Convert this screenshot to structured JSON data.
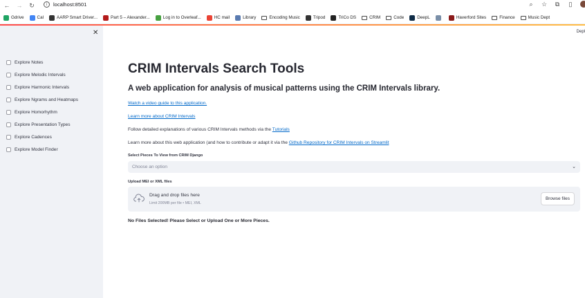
{
  "browser": {
    "url": "localhost:8501",
    "bookmarks": [
      {
        "label": "Gdrive",
        "color": "#1fa463"
      },
      {
        "label": "Cal",
        "color": "#4285f4"
      },
      {
        "label": "AARP Smart Driver...",
        "color": "#333333"
      },
      {
        "label": "Part 5 – Alexander...",
        "color": "#b31b1b"
      },
      {
        "label": "Log in to Overleaf...",
        "color": "#47a141"
      },
      {
        "label": "HC mail",
        "color": "#ea4335"
      },
      {
        "label": "Library",
        "color": "#5a7bb0"
      },
      {
        "label": "Encoding Music",
        "color": "folder"
      },
      {
        "label": "Tripod",
        "color": "#333333"
      },
      {
        "label": "TriCo DS",
        "color": "#222222"
      },
      {
        "label": "CRIM",
        "color": "folder"
      },
      {
        "label": "Code",
        "color": "folder"
      },
      {
        "label": "DeepL",
        "color": "#0f2b46"
      },
      {
        "label": "",
        "color": "#7a8fa8"
      },
      {
        "label": "Haverford Sites",
        "color": "#8b1a1a"
      },
      {
        "label": "Finance",
        "color": "folder"
      },
      {
        "label": "Music Dept",
        "color": "folder"
      }
    ]
  },
  "sidebar": {
    "items": [
      {
        "label": "Explore Notes"
      },
      {
        "label": "Explore Melodic Intervals"
      },
      {
        "label": "Explore Harmonic Intervals"
      },
      {
        "label": "Explore Ngrams and Heatmaps"
      },
      {
        "label": "Explore Homorhythm"
      },
      {
        "label": "Explore Presentation Types"
      },
      {
        "label": "Explore Cadences"
      },
      {
        "label": "Explore Model Finder"
      }
    ]
  },
  "header": {
    "deploy_label": "Depl"
  },
  "main": {
    "title": "CRIM Intervals Search Tools",
    "subtitle": "A web application for analysis of musical patterns using the CRIM Intervals library.",
    "video_link": "Watch a video guide to this application.",
    "learn_link": "Learn more about CRIM Intervals",
    "follow_text": "Follow detailed explanations of various CRIM Intervals methods via the",
    "tutorials_link": "Tutorials",
    "learn_more_text": "Learn more about this web application (and how to contribute or adapt it via the",
    "github_link": "Github Repository for CRIM Intervals on Streamlit",
    "select_label": "Select Pieces To View from CRIM Django",
    "select_placeholder": "Choose an option",
    "upload_label": "Upload MEI or XML files",
    "drag_title": "Drag and drop files here",
    "drag_sub": "Limit 200MB per file • MEI, XML",
    "browse_label": "Browse files",
    "status": "No Files Selected! Please Select or Upload One or More Pieces."
  }
}
